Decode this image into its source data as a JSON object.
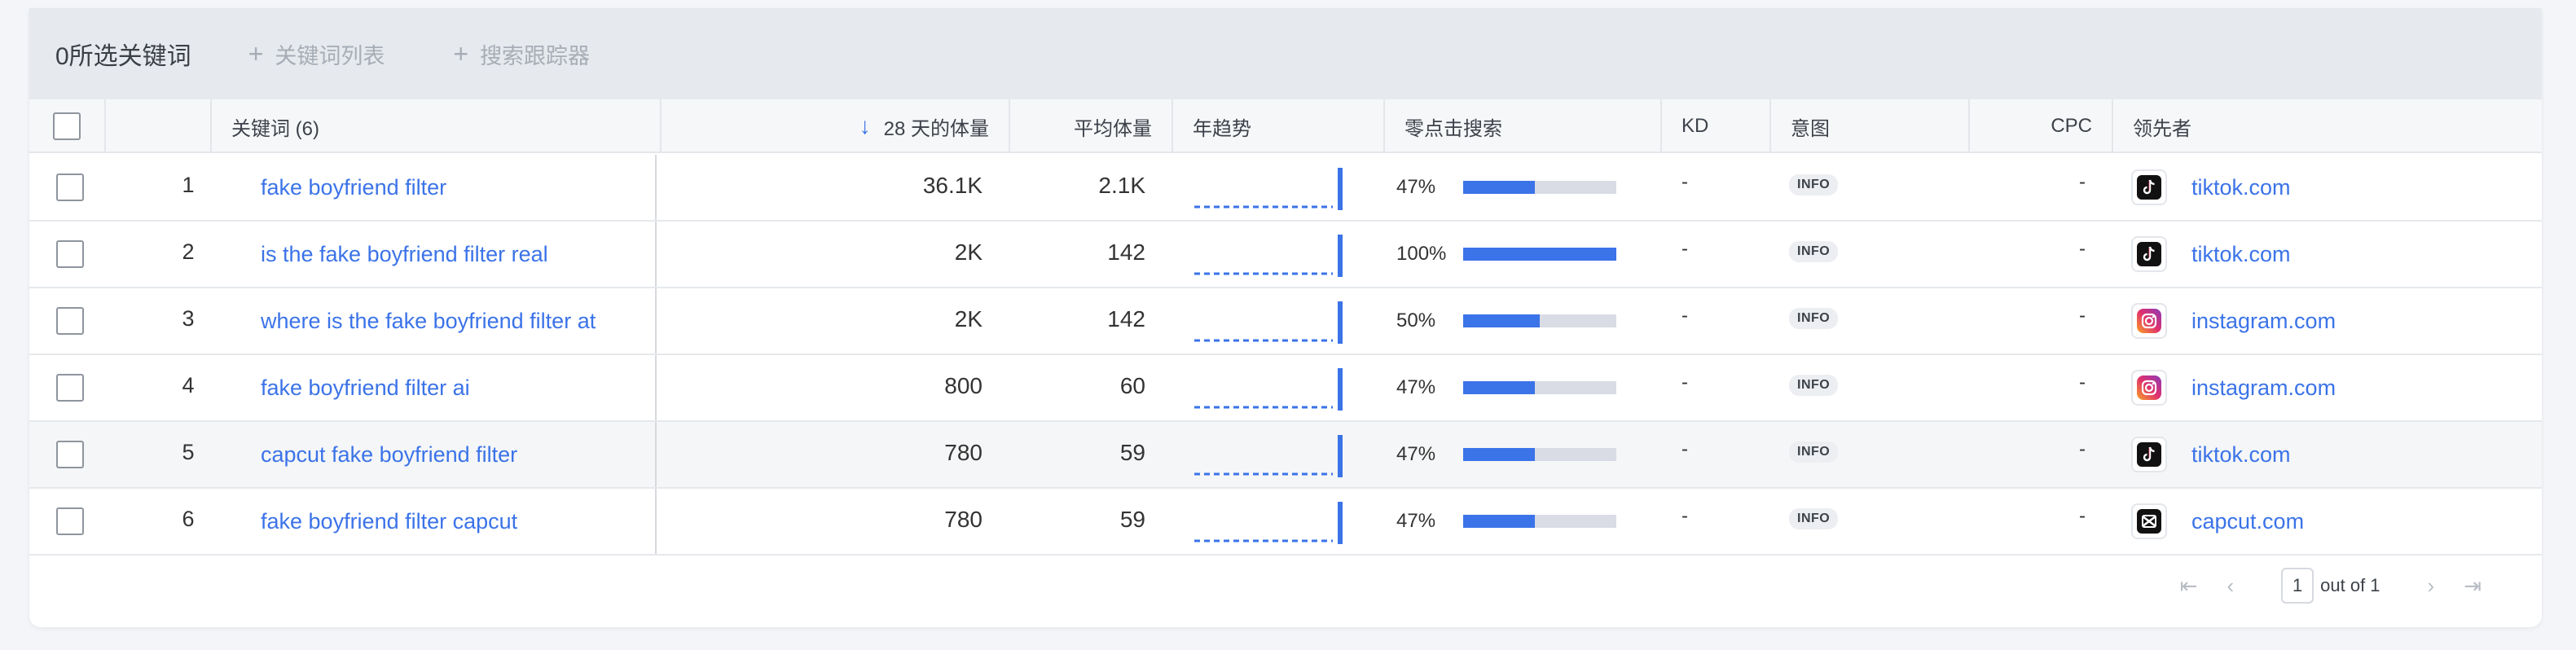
{
  "toolbar": {
    "selected": "0所选关键词",
    "kw_list": "关键词列表",
    "tracker": "搜索跟踪器"
  },
  "header": {
    "keyword": "关键词 (6)",
    "volume28": "28 天的体量",
    "avg": "平均体量",
    "trend": "年趋势",
    "zero_click": "零点击搜索",
    "kd": "KD",
    "intent": "意图",
    "cpc": "CPC",
    "leader": "领先者"
  },
  "rows": [
    {
      "num": "1",
      "keyword": "fake boyfriend filter",
      "volume": "36.1K",
      "avg": "2.1K",
      "zc": "47%",
      "zc_pct": 47,
      "kd": "-",
      "intent": "INFO",
      "cpc": "-",
      "leader": "tiktok.com",
      "leader_icon": "tiktok-icon"
    },
    {
      "num": "2",
      "keyword": "is the fake boyfriend filter real",
      "volume": "2K",
      "avg": "142",
      "zc": "100%",
      "zc_pct": 100,
      "kd": "-",
      "intent": "INFO",
      "cpc": "-",
      "leader": "tiktok.com",
      "leader_icon": "tiktok-icon"
    },
    {
      "num": "3",
      "keyword": "where is the fake boyfriend filter at",
      "volume": "2K",
      "avg": "142",
      "zc": "50%",
      "zc_pct": 50,
      "kd": "-",
      "intent": "INFO",
      "cpc": "-",
      "leader": "instagram.com",
      "leader_icon": "instagram-icon"
    },
    {
      "num": "4",
      "keyword": "fake boyfriend filter ai",
      "volume": "800",
      "avg": "60",
      "zc": "47%",
      "zc_pct": 47,
      "kd": "-",
      "intent": "INFO",
      "cpc": "-",
      "leader": "instagram.com",
      "leader_icon": "instagram-icon"
    },
    {
      "num": "5",
      "keyword": "capcut fake boyfriend filter",
      "volume": "780",
      "avg": "59",
      "zc": "47%",
      "zc_pct": 47,
      "kd": "-",
      "intent": "INFO",
      "cpc": "-",
      "leader": "tiktok.com",
      "leader_icon": "tiktok-icon"
    },
    {
      "num": "6",
      "keyword": "fake boyfriend filter capcut",
      "volume": "780",
      "avg": "59",
      "zc": "47%",
      "zc_pct": 47,
      "kd": "-",
      "intent": "INFO",
      "cpc": "-",
      "leader": "capcut.com",
      "leader_icon": "capcut-icon"
    }
  ],
  "pager": {
    "page": "1",
    "out_of": "out of 1"
  },
  "colors": {
    "accent": "#3b73e8",
    "toolbar_bg": "#e6e9ed"
  }
}
